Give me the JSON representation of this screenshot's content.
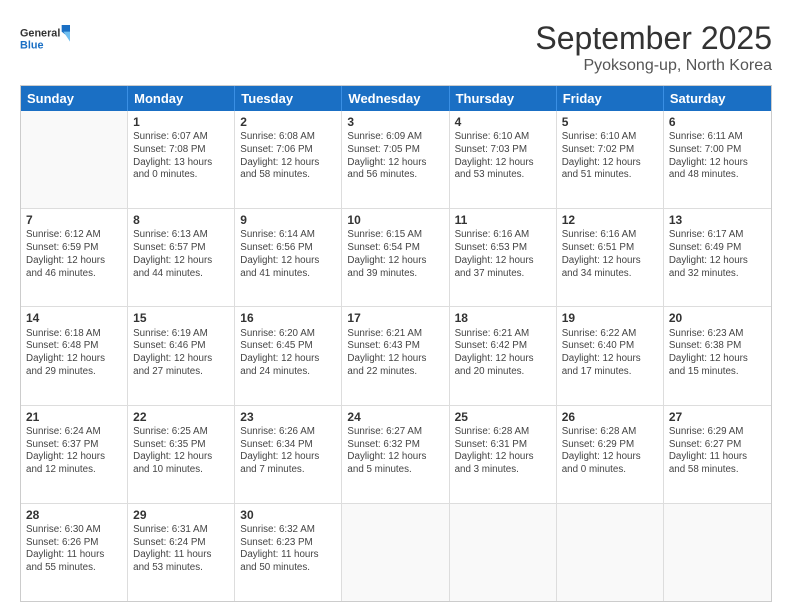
{
  "logo": {
    "line1": "General",
    "line2": "Blue"
  },
  "title": "September 2025",
  "subtitle": "Pyoksong-up, North Korea",
  "days_of_week": [
    "Sunday",
    "Monday",
    "Tuesday",
    "Wednesday",
    "Thursday",
    "Friday",
    "Saturday"
  ],
  "weeks": [
    [
      {
        "day": "",
        "sunrise": "",
        "sunset": "",
        "daylight": "",
        "empty": true
      },
      {
        "day": "1",
        "sunrise": "Sunrise: 6:07 AM",
        "sunset": "Sunset: 7:08 PM",
        "daylight": "Daylight: 13 hours and 0 minutes."
      },
      {
        "day": "2",
        "sunrise": "Sunrise: 6:08 AM",
        "sunset": "Sunset: 7:06 PM",
        "daylight": "Daylight: 12 hours and 58 minutes."
      },
      {
        "day": "3",
        "sunrise": "Sunrise: 6:09 AM",
        "sunset": "Sunset: 7:05 PM",
        "daylight": "Daylight: 12 hours and 56 minutes."
      },
      {
        "day": "4",
        "sunrise": "Sunrise: 6:10 AM",
        "sunset": "Sunset: 7:03 PM",
        "daylight": "Daylight: 12 hours and 53 minutes."
      },
      {
        "day": "5",
        "sunrise": "Sunrise: 6:10 AM",
        "sunset": "Sunset: 7:02 PM",
        "daylight": "Daylight: 12 hours and 51 minutes."
      },
      {
        "day": "6",
        "sunrise": "Sunrise: 6:11 AM",
        "sunset": "Sunset: 7:00 PM",
        "daylight": "Daylight: 12 hours and 48 minutes."
      }
    ],
    [
      {
        "day": "7",
        "sunrise": "Sunrise: 6:12 AM",
        "sunset": "Sunset: 6:59 PM",
        "daylight": "Daylight: 12 hours and 46 minutes."
      },
      {
        "day": "8",
        "sunrise": "Sunrise: 6:13 AM",
        "sunset": "Sunset: 6:57 PM",
        "daylight": "Daylight: 12 hours and 44 minutes."
      },
      {
        "day": "9",
        "sunrise": "Sunrise: 6:14 AM",
        "sunset": "Sunset: 6:56 PM",
        "daylight": "Daylight: 12 hours and 41 minutes."
      },
      {
        "day": "10",
        "sunrise": "Sunrise: 6:15 AM",
        "sunset": "Sunset: 6:54 PM",
        "daylight": "Daylight: 12 hours and 39 minutes."
      },
      {
        "day": "11",
        "sunrise": "Sunrise: 6:16 AM",
        "sunset": "Sunset: 6:53 PM",
        "daylight": "Daylight: 12 hours and 37 minutes."
      },
      {
        "day": "12",
        "sunrise": "Sunrise: 6:16 AM",
        "sunset": "Sunset: 6:51 PM",
        "daylight": "Daylight: 12 hours and 34 minutes."
      },
      {
        "day": "13",
        "sunrise": "Sunrise: 6:17 AM",
        "sunset": "Sunset: 6:49 PM",
        "daylight": "Daylight: 12 hours and 32 minutes."
      }
    ],
    [
      {
        "day": "14",
        "sunrise": "Sunrise: 6:18 AM",
        "sunset": "Sunset: 6:48 PM",
        "daylight": "Daylight: 12 hours and 29 minutes."
      },
      {
        "day": "15",
        "sunrise": "Sunrise: 6:19 AM",
        "sunset": "Sunset: 6:46 PM",
        "daylight": "Daylight: 12 hours and 27 minutes."
      },
      {
        "day": "16",
        "sunrise": "Sunrise: 6:20 AM",
        "sunset": "Sunset: 6:45 PM",
        "daylight": "Daylight: 12 hours and 24 minutes."
      },
      {
        "day": "17",
        "sunrise": "Sunrise: 6:21 AM",
        "sunset": "Sunset: 6:43 PM",
        "daylight": "Daylight: 12 hours and 22 minutes."
      },
      {
        "day": "18",
        "sunrise": "Sunrise: 6:21 AM",
        "sunset": "Sunset: 6:42 PM",
        "daylight": "Daylight: 12 hours and 20 minutes."
      },
      {
        "day": "19",
        "sunrise": "Sunrise: 6:22 AM",
        "sunset": "Sunset: 6:40 PM",
        "daylight": "Daylight: 12 hours and 17 minutes."
      },
      {
        "day": "20",
        "sunrise": "Sunrise: 6:23 AM",
        "sunset": "Sunset: 6:38 PM",
        "daylight": "Daylight: 12 hours and 15 minutes."
      }
    ],
    [
      {
        "day": "21",
        "sunrise": "Sunrise: 6:24 AM",
        "sunset": "Sunset: 6:37 PM",
        "daylight": "Daylight: 12 hours and 12 minutes."
      },
      {
        "day": "22",
        "sunrise": "Sunrise: 6:25 AM",
        "sunset": "Sunset: 6:35 PM",
        "daylight": "Daylight: 12 hours and 10 minutes."
      },
      {
        "day": "23",
        "sunrise": "Sunrise: 6:26 AM",
        "sunset": "Sunset: 6:34 PM",
        "daylight": "Daylight: 12 hours and 7 minutes."
      },
      {
        "day": "24",
        "sunrise": "Sunrise: 6:27 AM",
        "sunset": "Sunset: 6:32 PM",
        "daylight": "Daylight: 12 hours and 5 minutes."
      },
      {
        "day": "25",
        "sunrise": "Sunrise: 6:28 AM",
        "sunset": "Sunset: 6:31 PM",
        "daylight": "Daylight: 12 hours and 3 minutes."
      },
      {
        "day": "26",
        "sunrise": "Sunrise: 6:28 AM",
        "sunset": "Sunset: 6:29 PM",
        "daylight": "Daylight: 12 hours and 0 minutes."
      },
      {
        "day": "27",
        "sunrise": "Sunrise: 6:29 AM",
        "sunset": "Sunset: 6:27 PM",
        "daylight": "Daylight: 11 hours and 58 minutes."
      }
    ],
    [
      {
        "day": "28",
        "sunrise": "Sunrise: 6:30 AM",
        "sunset": "Sunset: 6:26 PM",
        "daylight": "Daylight: 11 hours and 55 minutes."
      },
      {
        "day": "29",
        "sunrise": "Sunrise: 6:31 AM",
        "sunset": "Sunset: 6:24 PM",
        "daylight": "Daylight: 11 hours and 53 minutes."
      },
      {
        "day": "30",
        "sunrise": "Sunrise: 6:32 AM",
        "sunset": "Sunset: 6:23 PM",
        "daylight": "Daylight: 11 hours and 50 minutes."
      },
      {
        "day": "",
        "sunrise": "",
        "sunset": "",
        "daylight": "",
        "empty": true
      },
      {
        "day": "",
        "sunrise": "",
        "sunset": "",
        "daylight": "",
        "empty": true
      },
      {
        "day": "",
        "sunrise": "",
        "sunset": "",
        "daylight": "",
        "empty": true
      },
      {
        "day": "",
        "sunrise": "",
        "sunset": "",
        "daylight": "",
        "empty": true
      }
    ]
  ]
}
